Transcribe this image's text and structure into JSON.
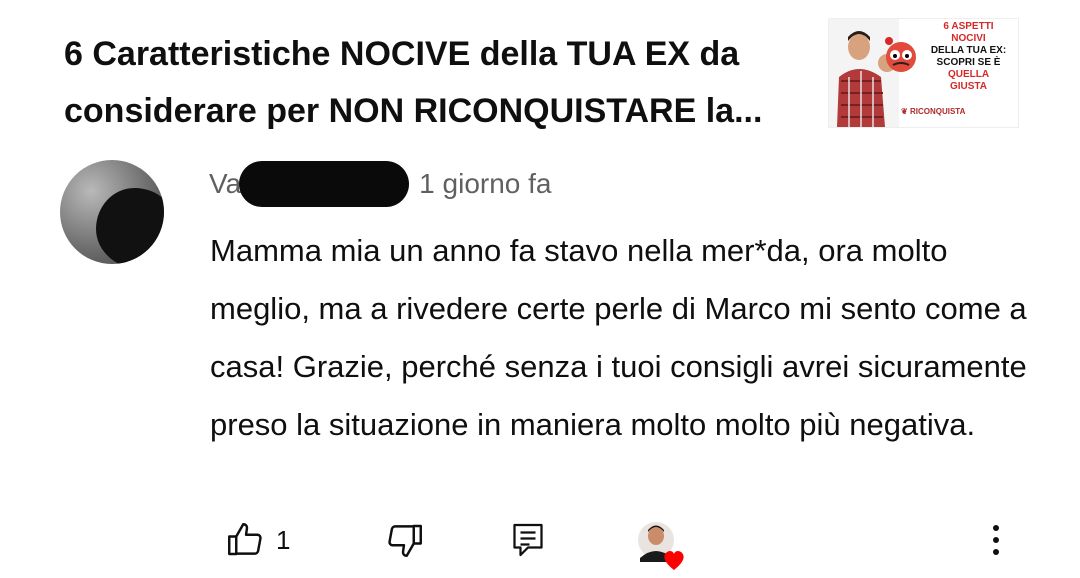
{
  "video": {
    "title": "6 Caratteristiche NOCIVE della TUA EX da considerare per NON RICONQUISTARE la...",
    "thumbnail": {
      "line1": "6 ASPETTI",
      "line2": "NOCIVI",
      "line3": "DELLA TUA EX:",
      "line4": "SCOPRI SE È",
      "line5": "QUELLA",
      "line6": "GIUSTA",
      "brand": "RICONQUISTA"
    }
  },
  "comment": {
    "author_visible": "Va",
    "timestamp": "1 giorno fa",
    "text": "Mamma mia un anno fa stavo nella mer*da, ora molto meglio, ma a rivedere certe perle di Marco mi sento come a casa! Grazie, perché senza i tuoi consigli avrei sicuramente preso la situazione in maniera molto molto più negativa.",
    "like_count": "1"
  },
  "icons": {
    "like": "thumbs-up-icon",
    "dislike": "thumbs-down-icon",
    "reply": "reply-comment-icon",
    "creator_heart": "creator-heart-icon",
    "more": "more-vertical-icon"
  },
  "colors": {
    "text": "#0f0f0f",
    "secondary": "#606060",
    "heart": "#ff0000",
    "thumb_red": "#d62828"
  }
}
